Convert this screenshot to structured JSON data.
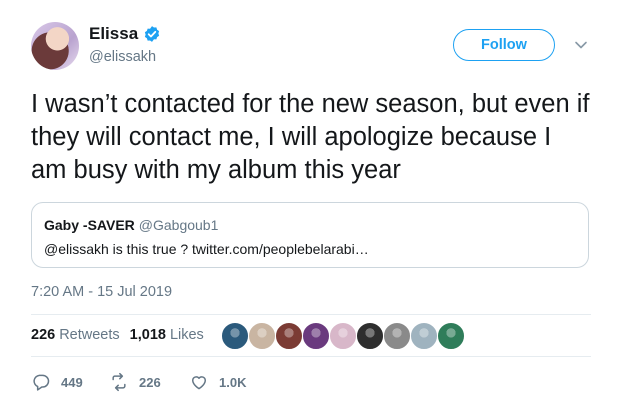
{
  "author": {
    "display_name": "Elissa",
    "handle": "@elissakh",
    "verified": true
  },
  "follow_button": {
    "label": "Follow"
  },
  "tweet": {
    "text": "I wasn’t contacted for the new season, but even if they will contact me, I will apologize because I am busy with my album this year",
    "timestamp": "7:20 AM - 15 Jul 2019"
  },
  "quoted_tweet": {
    "display_name": "Gaby -SAVER",
    "handle": "@Gabgoub1",
    "text": "@elissakh is this true ? twitter.com/peoplebelarabi…"
  },
  "stats": {
    "retweets_count": "226",
    "retweets_label": "Retweets",
    "likes_count": "1,018",
    "likes_label": "Likes"
  },
  "likers": [
    {
      "name": "liker-avatar-1",
      "color": "#2b5a7c"
    },
    {
      "name": "liker-avatar-2",
      "color": "#c9b5a2"
    },
    {
      "name": "liker-avatar-3",
      "color": "#7b3b34"
    },
    {
      "name": "liker-avatar-4",
      "color": "#6a3a7e"
    },
    {
      "name": "liker-avatar-5",
      "color": "#d8b7c9"
    },
    {
      "name": "liker-avatar-6",
      "color": "#2e2e2e"
    },
    {
      "name": "liker-avatar-7",
      "color": "#8a8a8a"
    },
    {
      "name": "liker-avatar-8",
      "color": "#9fb3bf"
    },
    {
      "name": "liker-avatar-9",
      "color": "#2f7d5a"
    }
  ],
  "actions": {
    "reply_count": "449",
    "retweet_count": "226",
    "like_count": "1.0K"
  },
  "colors": {
    "accent": "#1da1f2",
    "text": "#14171a",
    "secondary_text": "#657786",
    "border": "#ccd6dd"
  }
}
